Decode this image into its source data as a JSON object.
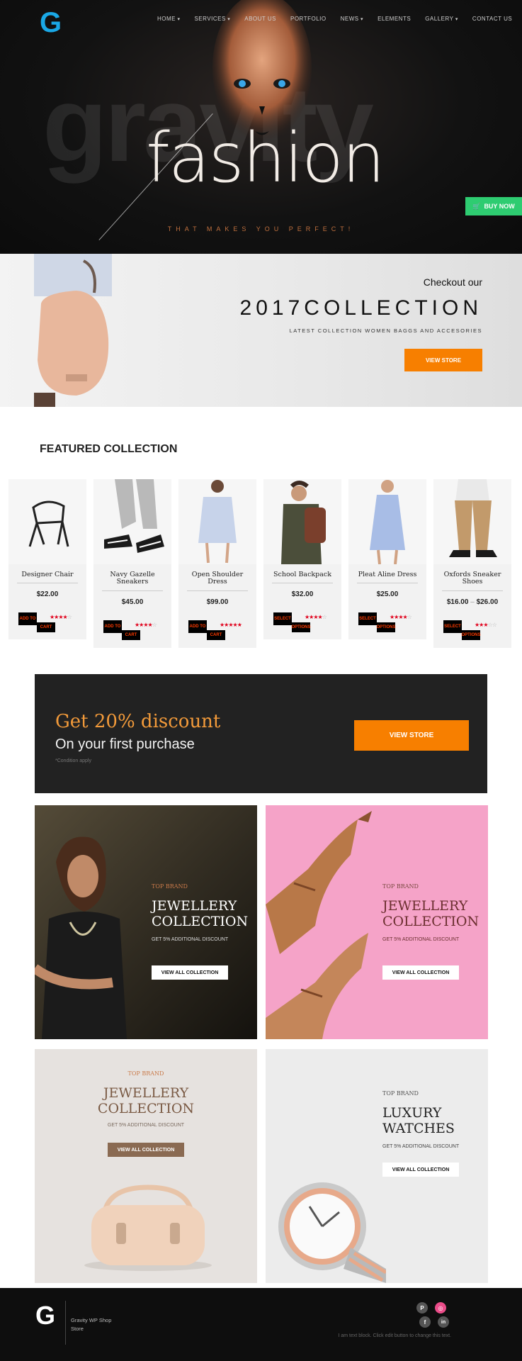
{
  "header": {
    "logo": "G",
    "nav": [
      {
        "label": "HOME",
        "dropdown": true
      },
      {
        "label": "SERVICES",
        "dropdown": true
      },
      {
        "label": "ABOUT US",
        "dropdown": false
      },
      {
        "label": "PORTFOLIO",
        "dropdown": false
      },
      {
        "label": "NEWS",
        "dropdown": true
      },
      {
        "label": "ELEMENTS",
        "dropdown": false
      },
      {
        "label": "GALLERY",
        "dropdown": true
      },
      {
        "label": "CONTACT US",
        "dropdown": false
      }
    ]
  },
  "hero": {
    "background_word": "gravity",
    "headline": "fashion",
    "tagline": "THAT MAKES YOU PERFECT!",
    "buy_button": "BUY NOW"
  },
  "collection_banner": {
    "lead": "Checkout our",
    "title": "2017COLLECTION",
    "subtitle": "LATEST COLLECTION WOMEN BAGGS AND ACCESORIES",
    "button": "VIEW STORE"
  },
  "featured": {
    "title_bold": "FEATURED",
    "title_rest": "COLLECTION",
    "products": [
      {
        "name": "Designer Chair",
        "price": "$22.00",
        "action": [
          "ADD TO",
          "CART"
        ],
        "rating": 4
      },
      {
        "name": "Navy Gazelle Sneakers",
        "price": "$45.00",
        "action": [
          "ADD TO",
          "CART"
        ],
        "rating": 4
      },
      {
        "name": "Open Shoulder Dress",
        "price": "$99.00",
        "action": [
          "ADD TO",
          "CART"
        ],
        "rating": 5
      },
      {
        "name": "School Backpack",
        "price": "$32.00",
        "action": [
          "SELECT",
          "OPTIONS"
        ],
        "rating": 4
      },
      {
        "name": "Pleat Aline Dress",
        "price": "$25.00",
        "action": [
          "SELECT",
          "OPTIONS"
        ],
        "rating": 4
      },
      {
        "name": "Oxfords Sneaker Shoes",
        "price": "$16.00",
        "price_to": "$26.00",
        "price_sep": "–",
        "action": [
          "SELECT",
          "OPTIONS"
        ],
        "rating": 3
      }
    ]
  },
  "discount": {
    "title": "Get 20% discount",
    "subtitle": "On your first purchase",
    "note": "*Condition apply",
    "button": "VIEW STORE"
  },
  "tiles": [
    {
      "brand": "TOP BRAND",
      "title_1": "JEWELLERY",
      "title_2": "COLLECTION",
      "sub": "GET 5% ADDITIONAL DISCOUNT",
      "button": "VIEW ALL COLLECTION"
    },
    {
      "brand": "TOP BRAND",
      "title_1": "JEWELLERY",
      "title_2": "COLLECTION",
      "sub": "GET 5% ADDITIONAL DISCOUNT",
      "button": "VIEW ALL COLLECTION"
    },
    {
      "brand": "TOP BRAND",
      "title_1": "JEWELLERY",
      "title_2": "COLLECTION",
      "sub": "GET 5% ADDITIONAL DISCOUNT",
      "button": "VIEW ALL COLLECTION"
    },
    {
      "brand": "TOP BRAND",
      "title_1": "LUXURY",
      "title_2": "WATCHES",
      "sub": "GET 5% ADDITIONAL DISCOUNT",
      "button": "VIEW ALL COLLECTION"
    }
  ],
  "footer": {
    "logo": "G",
    "name_1": "Gravity WP Shop",
    "name_2": "Store",
    "social_icons": [
      "pinterest-icon",
      "dribbble-icon",
      "facebook-icon",
      "linkedin-icon"
    ],
    "text": "I am text block. Click edit button to change this text."
  },
  "colors": {
    "accent_orange": "#f77f00",
    "buy_green": "#2ecc71",
    "logo_blue": "#1aa8e6",
    "star_red": "#e0001b"
  }
}
